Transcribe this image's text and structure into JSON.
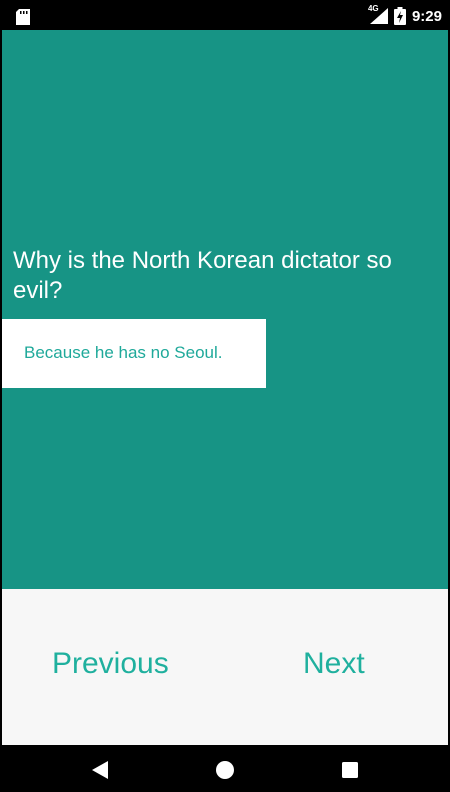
{
  "status_bar": {
    "network_label": "4G",
    "time": "9:29",
    "icons": [
      "sd-card-icon",
      "signal-icon",
      "battery-charging-icon"
    ]
  },
  "card": {
    "question": "Why is the North Korean dictator so evil?",
    "answer": "Because he has no Seoul."
  },
  "buttons": {
    "previous_label": "Previous",
    "next_label": "Next"
  },
  "nav_bar": {
    "icons": [
      "back-icon",
      "home-icon",
      "recents-icon"
    ]
  },
  "colors": {
    "primary": "#179485",
    "accent": "#1fb09e",
    "answer_text": "#1fa99a",
    "background": "#f7f7f7"
  }
}
